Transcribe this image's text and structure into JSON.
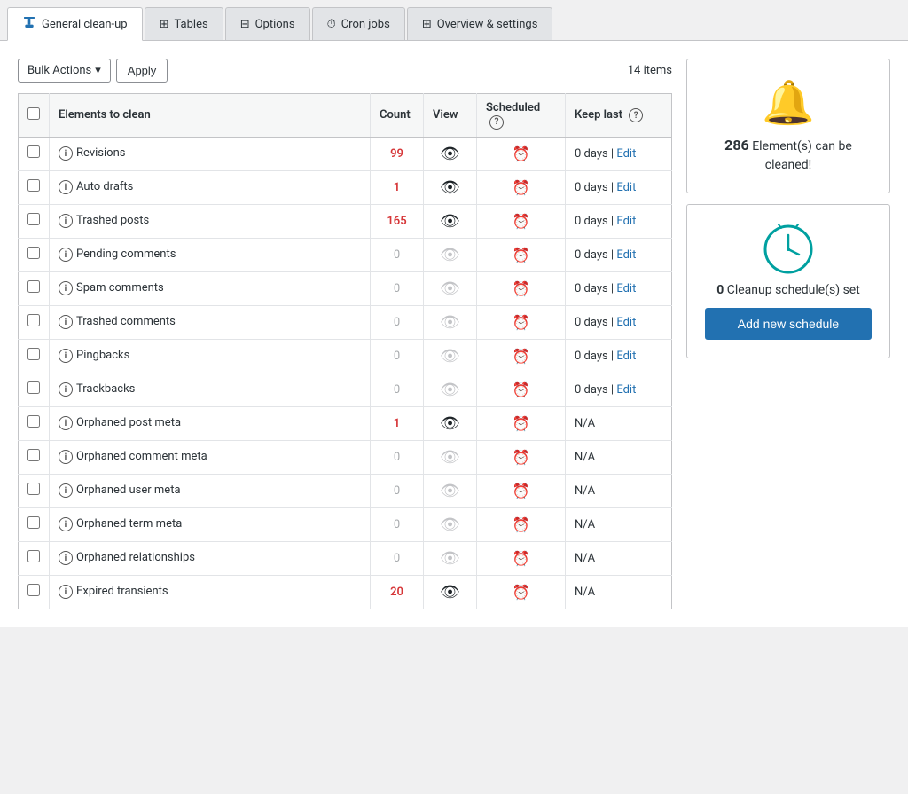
{
  "tabs": [
    {
      "id": "general-cleanup",
      "label": "General clean-up",
      "active": true,
      "icon": "broom"
    },
    {
      "id": "tables",
      "label": "Tables",
      "active": false,
      "icon": "table"
    },
    {
      "id": "options",
      "label": "Options",
      "active": false,
      "icon": "options"
    },
    {
      "id": "cron-jobs",
      "label": "Cron jobs",
      "active": false,
      "icon": "clock"
    },
    {
      "id": "overview-settings",
      "label": "Overview & settings",
      "active": false,
      "icon": "overview"
    }
  ],
  "toolbar": {
    "bulk_actions_label": "Bulk Actions",
    "apply_label": "Apply",
    "items_count": "14 items"
  },
  "table": {
    "headers": {
      "element": "Elements to clean",
      "count": "Count",
      "view": "View",
      "scheduled": "Scheduled",
      "keep_last": "Keep last"
    },
    "rows": [
      {
        "id": 1,
        "name": "Revisions",
        "count": 99,
        "count_color": "red",
        "view_active": true,
        "scheduled": false,
        "keep": "0 days",
        "keep_edit": true
      },
      {
        "id": 2,
        "name": "Auto drafts",
        "count": 1,
        "count_color": "red",
        "view_active": true,
        "scheduled": false,
        "keep": "0 days",
        "keep_edit": true
      },
      {
        "id": 3,
        "name": "Trashed posts",
        "count": 165,
        "count_color": "red",
        "view_active": true,
        "scheduled": false,
        "keep": "0 days",
        "keep_edit": true
      },
      {
        "id": 4,
        "name": "Pending comments",
        "count": 0,
        "count_color": "zero",
        "view_active": false,
        "scheduled": false,
        "keep": "0 days",
        "keep_edit": true
      },
      {
        "id": 5,
        "name": "Spam comments",
        "count": 0,
        "count_color": "zero",
        "view_active": false,
        "scheduled": false,
        "keep": "0 days",
        "keep_edit": true
      },
      {
        "id": 6,
        "name": "Trashed comments",
        "count": 0,
        "count_color": "zero",
        "view_active": false,
        "scheduled": false,
        "keep": "0 days",
        "keep_edit": true
      },
      {
        "id": 7,
        "name": "Pingbacks",
        "count": 0,
        "count_color": "zero",
        "view_active": false,
        "scheduled": false,
        "keep": "0 days",
        "keep_edit": true
      },
      {
        "id": 8,
        "name": "Trackbacks",
        "count": 0,
        "count_color": "zero",
        "view_active": false,
        "scheduled": false,
        "keep": "0 days",
        "keep_edit": true
      },
      {
        "id": 9,
        "name": "Orphaned post meta",
        "count": 1,
        "count_color": "red",
        "view_active": true,
        "scheduled": false,
        "keep": "N/A",
        "keep_edit": false
      },
      {
        "id": 10,
        "name": "Orphaned comment meta",
        "count": 0,
        "count_color": "zero",
        "view_active": false,
        "scheduled": false,
        "keep": "N/A",
        "keep_edit": false
      },
      {
        "id": 11,
        "name": "Orphaned user meta",
        "count": 0,
        "count_color": "zero",
        "view_active": false,
        "scheduled": false,
        "keep": "N/A",
        "keep_edit": false
      },
      {
        "id": 12,
        "name": "Orphaned term meta",
        "count": 0,
        "count_color": "zero",
        "view_active": false,
        "scheduled": false,
        "keep": "N/A",
        "keep_edit": false
      },
      {
        "id": 13,
        "name": "Orphaned relationships",
        "count": 0,
        "count_color": "zero",
        "view_active": false,
        "scheduled": false,
        "keep": "N/A",
        "keep_edit": false
      },
      {
        "id": 14,
        "name": "Expired transients",
        "count": 20,
        "count_color": "red",
        "view_active": true,
        "scheduled": false,
        "keep": "N/A",
        "keep_edit": false
      }
    ]
  },
  "sidebar": {
    "elements_count": "286",
    "elements_text": "Element(s) can be cleaned!",
    "schedules_count": "0",
    "schedules_text": "Cleanup schedule(s) set",
    "add_schedule_label": "Add new schedule"
  }
}
